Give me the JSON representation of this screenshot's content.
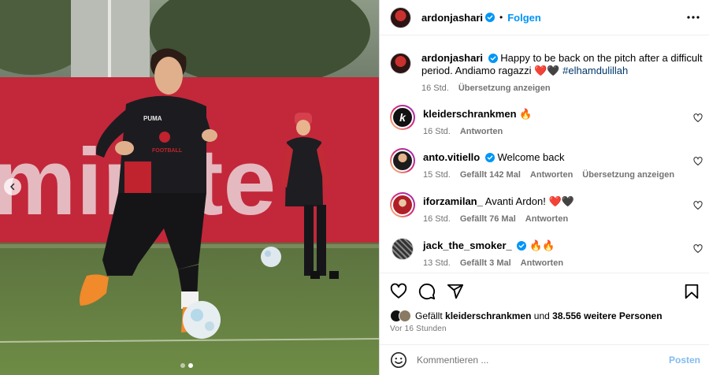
{
  "colors": {
    "accent": "#0095f6",
    "text_secondary": "#737373",
    "heart_red": "#ed4956",
    "post_disabled": "#82bbf0"
  },
  "photo": {
    "banner_text": "mirate",
    "shirt_brand": "PUMA",
    "shirt_sponsor": "FOOTBALL",
    "carousel": {
      "total": 2,
      "active_index": 1
    },
    "prev_icon": "chevron-left-icon"
  },
  "header": {
    "username": "ardonjashari",
    "verified": true,
    "separator": "•",
    "follow_label": "Folgen",
    "more_icon": "more-horizontal-icon"
  },
  "caption": {
    "username": "ardonjashari",
    "text": "Happy to be back on the pitch after a difficult period. Andiamo ragazzi",
    "emojis": "❤️🖤",
    "hashtag": "#elhamdulillah",
    "time": "16 Std.",
    "translate_label": "Übersetzung anzeigen"
  },
  "comments": [
    {
      "username": "kleiderschrankmen",
      "verified": false,
      "text": "🔥",
      "time": "16 Std.",
      "likes": "",
      "reply_label": "Antworten",
      "translate_label": ""
    },
    {
      "username": "anto.vitiello",
      "verified": true,
      "text": "Welcome back",
      "time": "15 Std.",
      "likes": "Gefällt 142 Mal",
      "reply_label": "Antworten",
      "translate_label": "Übersetzung anzeigen"
    },
    {
      "username": "iforzamilan_",
      "verified": false,
      "text": "Avanti Ardon! ❤️🖤",
      "time": "16 Std.",
      "likes": "Gefällt 76 Mal",
      "reply_label": "Antworten",
      "translate_label": ""
    },
    {
      "username": "jack_the_smoker_",
      "verified": true,
      "text": "🔥🔥",
      "time": "13 Std.",
      "likes": "Gefällt 3 Mal",
      "reply_label": "Antworten",
      "translate_label": ""
    }
  ],
  "actions": {
    "icons": [
      "heart-icon",
      "comment-icon",
      "share-icon",
      "bookmark-icon"
    ],
    "likes_prefix": "Gefällt",
    "likes_user": "kleiderschrankmen",
    "likes_connector": "und",
    "likes_others": "38.556 weitere Personen",
    "timestamp": "Vor 16 Stunden"
  },
  "composer": {
    "placeholder": "Kommentieren ...",
    "post_label": "Posten",
    "emoji_icon": "smiley-icon"
  }
}
